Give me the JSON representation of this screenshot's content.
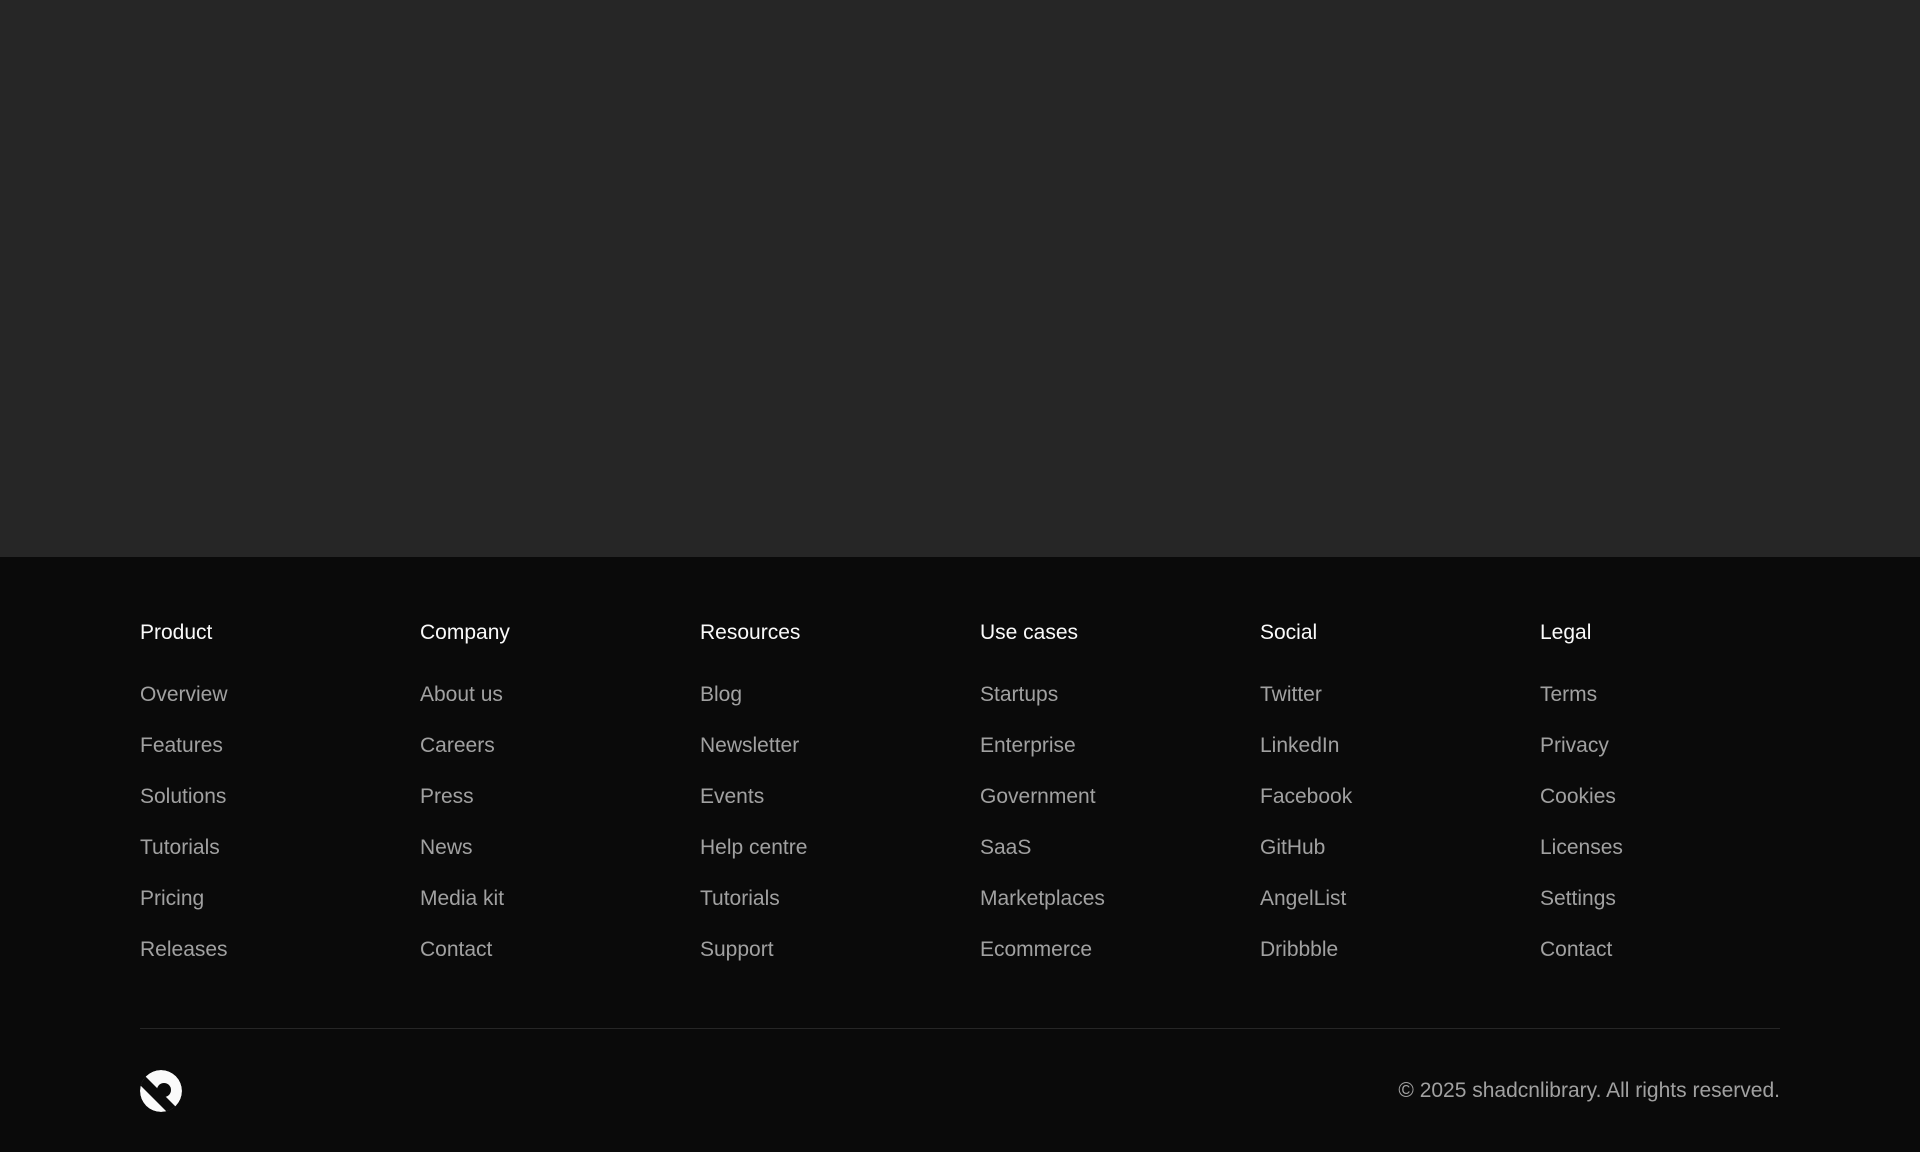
{
  "colors": {
    "hero_bg": "#262626",
    "footer_bg": "#0a0a0a",
    "heading": "#fafafa",
    "link": "#a1a1a1",
    "divider": "#262626"
  },
  "footer": {
    "columns": [
      {
        "title": "Product",
        "links": [
          "Overview",
          "Features",
          "Solutions",
          "Tutorials",
          "Pricing",
          "Releases"
        ]
      },
      {
        "title": "Company",
        "links": [
          "About us",
          "Careers",
          "Press",
          "News",
          "Media kit",
          "Contact"
        ]
      },
      {
        "title": "Resources",
        "links": [
          "Blog",
          "Newsletter",
          "Events",
          "Help centre",
          "Tutorials",
          "Support"
        ]
      },
      {
        "title": "Use cases",
        "links": [
          "Startups",
          "Enterprise",
          "Government",
          "SaaS",
          "Marketplaces",
          "Ecommerce"
        ]
      },
      {
        "title": "Social",
        "links": [
          "Twitter",
          "LinkedIn",
          "Facebook",
          "GitHub",
          "AngelList",
          "Dribbble"
        ]
      },
      {
        "title": "Legal",
        "links": [
          "Terms",
          "Privacy",
          "Cookies",
          "Licenses",
          "Settings",
          "Contact"
        ]
      }
    ],
    "logo_icon": "brand-logo-icon",
    "copyright": "© 2025 shadcnlibrary. All rights reserved."
  }
}
